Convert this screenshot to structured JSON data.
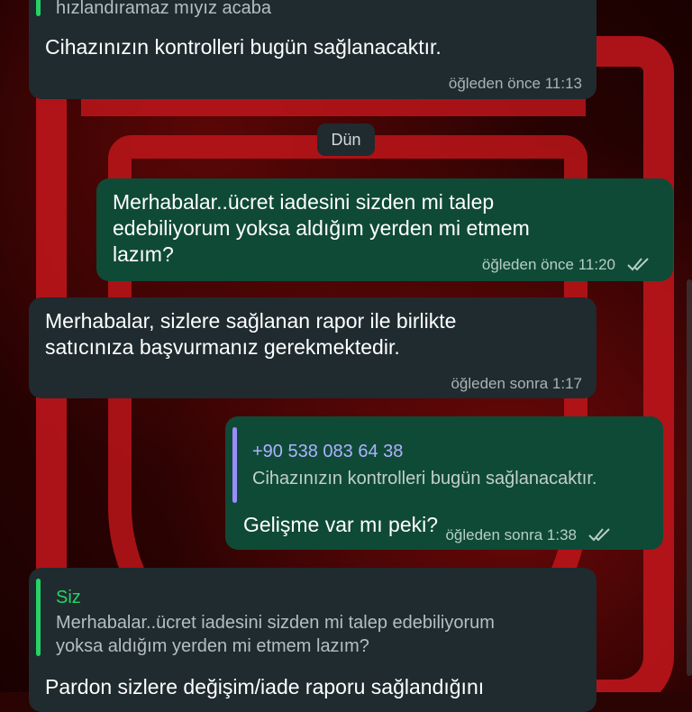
{
  "colors": {
    "incoming_bubble": "#1f2b2f",
    "outgoing_bubble": "#0f4a37",
    "reply_bar_green": "#25d366",
    "reply_bar_purple": "#9a8cff",
    "read_ticks": "#b7cec5",
    "wallpaper_red": "#c4161c"
  },
  "messages": {
    "m1": {
      "quote_text": "hızlandıramaz mıyız acaba",
      "text": "Cihazınızın kontrolleri bugün sağlanacaktır.",
      "time": "öğleden önce 11:13"
    },
    "date_separator": "Dün",
    "m2": {
      "text": "Merhabalar..ücret iadesini sizden mi talep\nedebiliyorum yoksa aldığım yerden mi etmem\nlazım?",
      "time": "öğleden önce 11:20",
      "status_icon": "double-check-icon"
    },
    "m3": {
      "text": "Merhabalar, sizlere sağlanan rapor ile birlikte\nsatıcınıza başvurmanız gerekmektedir.",
      "time": "öğleden sonra 1:17"
    },
    "m4": {
      "quote_author": "+90 538 083 64 38",
      "quote_text": "Cihazınızın kontrolleri bugün sağlanacaktır.",
      "text": "Gelişme var mı peki?",
      "time": "öğleden sonra 1:38",
      "status_icon": "double-check-icon"
    },
    "m5": {
      "quote_author": "Siz",
      "quote_text": "Merhabalar..ücret iadesini sizden mi talep edebiliyorum\nyoksa aldığım yerden mi etmem lazım?",
      "text": "Pardon sizlere değişim/iade raporu sağlandığını"
    }
  }
}
